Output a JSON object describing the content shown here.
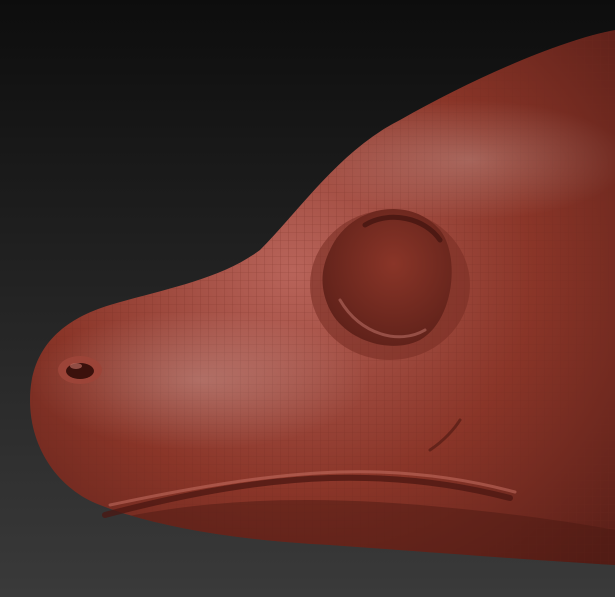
{
  "scene": {
    "subject": "sculpted-creature-head",
    "colors": {
      "background_top": "#0d0d0d",
      "background_bottom": "#3a3a3a",
      "clay_base": "#8a3528",
      "clay_light": "#b8645a",
      "clay_dark": "#5a1f18",
      "wire": "#6e2a20"
    }
  }
}
